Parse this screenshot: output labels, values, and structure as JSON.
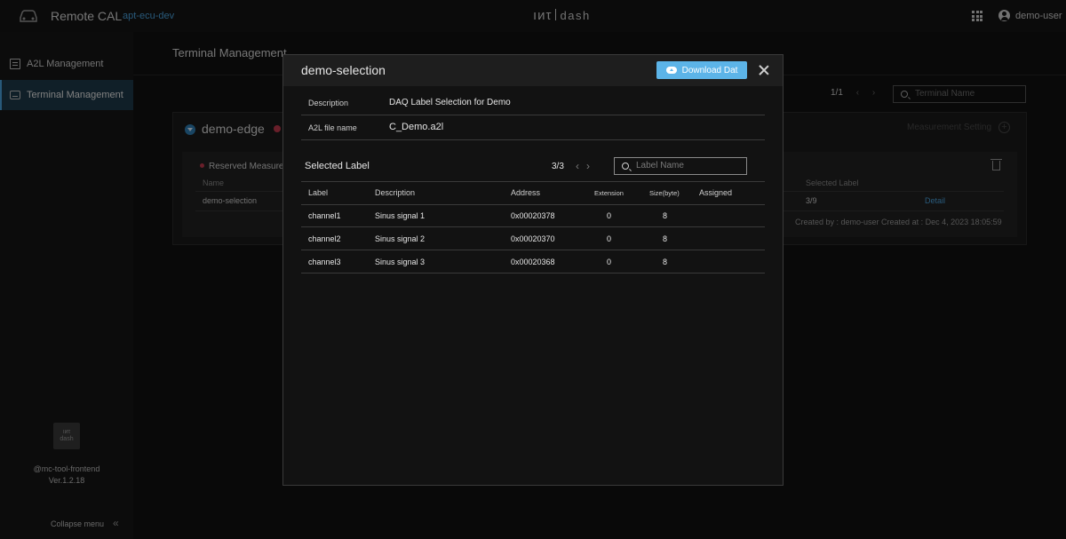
{
  "topbar": {
    "app_title": "Remote CAL",
    "env_name": "apt-ecu-dev",
    "brand_left": "ıиτ",
    "brand_right": "dash",
    "user_name": "demo-user"
  },
  "sidebar": {
    "items": [
      {
        "label": "A2L Management",
        "icon": "document-icon",
        "active": false
      },
      {
        "label": "Terminal Management",
        "icon": "terminal-icon",
        "active": true
      }
    ],
    "logo_text_top": "ıиτ",
    "logo_text_bottom": "dash",
    "package": "@mc-tool-frontend",
    "version": "Ver.1.2.18",
    "collapse_label": "Collapse menu",
    "collapse_icon": "«"
  },
  "main": {
    "title": "Terminal Management",
    "pager": "1/1",
    "search_placeholder": "Terminal Name",
    "edge": {
      "name": "demo-edge",
      "measurement_setting": "Measurement Setting",
      "reserved_label": "Reserved Measurem",
      "col_name": "Name",
      "col_selected": "Selected Label",
      "row_name": "demo-selection",
      "row_selected": "3/9",
      "row_detail": "Detail",
      "created": "Created by :  demo-user     Created at :  Dec 4, 2023 18:05:59"
    }
  },
  "modal": {
    "title": "demo-selection",
    "download_label": "Download Dat",
    "description_label": "Description",
    "description_value": "DAQ Label Selection for Demo",
    "a2l_label": "A2L file name",
    "a2l_value": "C_Demo.a2l",
    "selected_title": "Selected Label",
    "selected_count": "3/3",
    "search_placeholder": "Label Name",
    "columns": {
      "label": "Label",
      "description": "Description",
      "address": "Address",
      "extension": "Extension",
      "size": "Size(byte)",
      "assigned": "Assigned"
    },
    "rows": [
      {
        "label": "channel1",
        "description": "Sinus signal 1",
        "address": "0x00020378",
        "extension": "0",
        "size": "8",
        "assigned": ""
      },
      {
        "label": "channel2",
        "description": "Sinus signal 2",
        "address": "0x00020370",
        "extension": "0",
        "size": "8",
        "assigned": ""
      },
      {
        "label": "channel3",
        "description": "Sinus signal 3",
        "address": "0x00020368",
        "extension": "0",
        "size": "8",
        "assigned": ""
      }
    ]
  },
  "colors": {
    "accent": "#4aa3df",
    "button": "#5cb4e8",
    "status_red": "#c0394d",
    "active_nav": "#1e3a4a"
  }
}
